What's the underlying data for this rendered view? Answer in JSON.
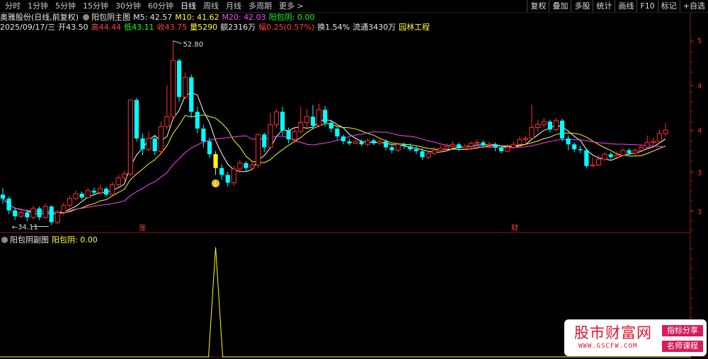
{
  "toolbar": {
    "tabs": [
      "分时",
      "1分钟",
      "5分钟",
      "15分钟",
      "30分钟",
      "60分钟",
      "日线",
      "周线",
      "月线",
      "多周期",
      "更多 >"
    ],
    "active_tab": "日线",
    "right_buttons": [
      "复权",
      "叠加",
      "多股",
      "统计",
      "画线",
      "F10",
      "标记",
      "+自选"
    ]
  },
  "info": {
    "stock_name": "奥雅股份(日线,前复权)",
    "indicator": "阳包阴主图",
    "ma5": "M5: 42.57",
    "ma10": "M10: 41.62",
    "ma20": "M20: 42.03",
    "ybyin": "阳包阴: 0.00",
    "date": "2025/09/17/三",
    "open": "开43.50",
    "high": "高44.44",
    "low": "低43.11",
    "close": "收43.75",
    "volume": "量5290",
    "amount": "额2316万",
    "change": "幅0.25(0.57%)",
    "turnover": "换1.54%",
    "float": "流通3430万",
    "sector": "园林工程"
  },
  "main_chart": {
    "max_label": "52.80",
    "min_label": "34.11",
    "marker_zhang": "涨",
    "marker_cai": "财",
    "right_ticks": [
      "5",
      "4",
      "4",
      "3",
      "3"
    ]
  },
  "sub_chart": {
    "title": "阳包阴副图",
    "value": "阳包阴: 0.00"
  },
  "watermark": {
    "main": "股市财富网",
    "url": "WWW.GSCFW.COM",
    "badge1": "指标分享",
    "badge2": "名师课程"
  },
  "colors": {
    "up": "#ff3030",
    "down": "#00ffff",
    "ma5": "#ffffff",
    "ma10": "#ffff00",
    "ma20": "#ff40ff",
    "signal": "#ffff00"
  },
  "chart_data": {
    "type": "candlestick",
    "candles": [
      [
        37.2,
        36.8,
        37.9,
        36.3
      ],
      [
        36.8,
        35.6,
        37.0,
        35.2
      ],
      [
        35.6,
        35.0,
        35.9,
        34.6
      ],
      [
        35.0,
        35.4,
        35.8,
        34.8
      ],
      [
        35.4,
        34.9,
        35.7,
        34.5
      ],
      [
        34.9,
        35.8,
        36.1,
        34.7
      ],
      [
        35.8,
        34.9,
        36.0,
        34.6
      ],
      [
        34.9,
        36.0,
        36.3,
        34.7
      ],
      [
        36.0,
        34.4,
        36.1,
        34.11
      ],
      [
        34.4,
        35.4,
        35.6,
        34.2
      ],
      [
        35.4,
        36.1,
        36.4,
        35.1
      ],
      [
        36.1,
        36.8,
        37.1,
        35.9
      ],
      [
        36.8,
        37.3,
        37.6,
        36.6
      ],
      [
        37.3,
        36.9,
        37.5,
        36.7
      ],
      [
        36.9,
        37.6,
        37.9,
        36.8
      ],
      [
        37.6,
        37.4,
        37.9,
        37.1
      ],
      [
        37.4,
        37.8,
        38.2,
        37.2
      ],
      [
        37.8,
        37.2,
        38.0,
        37.0
      ],
      [
        37.2,
        38.2,
        38.5,
        37.0
      ],
      [
        38.2,
        38.9,
        39.2,
        38.0
      ],
      [
        38.9,
        39.3,
        39.6,
        38.6
      ],
      [
        39.3,
        46.8,
        46.8,
        39.1
      ],
      [
        46.8,
        42.9,
        47.0,
        42.6
      ],
      [
        42.9,
        41.8,
        43.4,
        41.2
      ],
      [
        41.8,
        42.9,
        43.6,
        41.6
      ],
      [
        42.9,
        41.6,
        43.2,
        41.2
      ],
      [
        41.6,
        44.1,
        44.6,
        41.4
      ],
      [
        44.1,
        45.1,
        48.3,
        43.8
      ],
      [
        45.1,
        50.8,
        52.8,
        44.9
      ],
      [
        50.8,
        47.1,
        51.0,
        46.6
      ],
      [
        47.1,
        49.1,
        49.6,
        46.9
      ],
      [
        49.1,
        45.6,
        49.4,
        45.0
      ],
      [
        45.6,
        43.9,
        46.1,
        43.4
      ],
      [
        43.9,
        42.6,
        44.3,
        42.0
      ],
      [
        42.6,
        41.3,
        43.0,
        40.9
      ],
      [
        41.3,
        39.9,
        41.6,
        39.2
      ],
      [
        39.9,
        39.2,
        40.3,
        38.7
      ],
      [
        39.2,
        38.4,
        39.5,
        38.0
      ],
      [
        38.4,
        39.8,
        40.1,
        38.1
      ],
      [
        39.8,
        40.4,
        40.7,
        39.5
      ],
      [
        40.4,
        39.9,
        40.6,
        39.6
      ],
      [
        39.9,
        40.2,
        40.5,
        39.7
      ],
      [
        40.2,
        43.3,
        43.4,
        39.9
      ],
      [
        43.3,
        42.0,
        43.5,
        41.5
      ],
      [
        42.0,
        44.3,
        45.5,
        41.8
      ],
      [
        44.3,
        45.6,
        45.9,
        44.0
      ],
      [
        45.6,
        43.7,
        46.1,
        43.2
      ],
      [
        43.7,
        42.8,
        44.0,
        42.4
      ],
      [
        42.8,
        43.6,
        44.0,
        42.5
      ],
      [
        43.6,
        44.5,
        46.1,
        43.4
      ],
      [
        44.5,
        45.1,
        45.9,
        44.0
      ],
      [
        45.1,
        44.2,
        46.3,
        43.8
      ],
      [
        44.2,
        45.8,
        46.4,
        44.0
      ],
      [
        45.8,
        44.5,
        46.2,
        44.1
      ],
      [
        44.5,
        43.9,
        44.8,
        43.5
      ],
      [
        43.9,
        43.1,
        44.1,
        42.8
      ],
      [
        43.1,
        42.6,
        43.3,
        42.3
      ],
      [
        42.6,
        42.4,
        42.9,
        42.2
      ],
      [
        42.4,
        42.6,
        42.8,
        42.3
      ],
      [
        42.6,
        42.3,
        42.8,
        42.1
      ],
      [
        42.3,
        42.7,
        42.9,
        42.1
      ],
      [
        42.7,
        42.4,
        42.9,
        42.2
      ],
      [
        42.4,
        42.6,
        42.8,
        42.2
      ],
      [
        42.6,
        42.0,
        42.8,
        41.7
      ],
      [
        42.0,
        41.7,
        42.3,
        41.4
      ],
      [
        41.7,
        42.3,
        42.5,
        41.5
      ],
      [
        42.3,
        42.1,
        42.5,
        41.8
      ],
      [
        42.1,
        41.8,
        42.4,
        41.6
      ],
      [
        41.8,
        41.6,
        42.2,
        41.3
      ],
      [
        41.6,
        41.0,
        41.9,
        40.7
      ],
      [
        41.0,
        41.4,
        41.7,
        40.8
      ],
      [
        41.4,
        41.7,
        42.0,
        41.2
      ],
      [
        41.7,
        41.9,
        42.2,
        41.5
      ],
      [
        41.9,
        42.1,
        42.4,
        41.7
      ],
      [
        42.1,
        42.3,
        42.6,
        41.9
      ],
      [
        42.3,
        41.9,
        42.5,
        41.6
      ],
      [
        41.9,
        42.1,
        42.3,
        41.7
      ],
      [
        42.1,
        42.4,
        42.6,
        41.9
      ],
      [
        42.4,
        42.5,
        42.8,
        42.2
      ],
      [
        42.5,
        42.2,
        42.7,
        41.9
      ],
      [
        42.2,
        42.3,
        42.6,
        42.0
      ],
      [
        42.3,
        42.0,
        42.5,
        41.6
      ],
      [
        42.0,
        41.6,
        42.2,
        41.4
      ],
      [
        41.6,
        42.0,
        42.3,
        41.5
      ],
      [
        42.0,
        42.3,
        42.6,
        41.8
      ],
      [
        42.3,
        42.8,
        43.1,
        42.1
      ],
      [
        42.8,
        42.9,
        43.2,
        42.5
      ],
      [
        42.9,
        44.0,
        46.3,
        42.8
      ],
      [
        44.0,
        44.3,
        44.8,
        43.6
      ],
      [
        44.3,
        44.6,
        45.0,
        44.0
      ],
      [
        44.6,
        43.8,
        44.8,
        43.5
      ],
      [
        43.8,
        44.7,
        45.0,
        43.6
      ],
      [
        44.7,
        42.9,
        44.9,
        42.6
      ],
      [
        42.9,
        42.3,
        43.2,
        41.7
      ],
      [
        42.3,
        41.8,
        42.5,
        41.5
      ],
      [
        41.8,
        41.7,
        42.1,
        41.4
      ],
      [
        41.7,
        40.1,
        41.9,
        39.9
      ],
      [
        40.1,
        40.2,
        41.0,
        40.0
      ],
      [
        40.2,
        40.8,
        41.2,
        40.1
      ],
      [
        40.8,
        41.3,
        41.5,
        40.6
      ],
      [
        41.3,
        41.0,
        41.5,
        40.8
      ],
      [
        41.0,
        41.2,
        41.6,
        40.8
      ],
      [
        41.2,
        41.7,
        41.9,
        41.0
      ],
      [
        41.7,
        41.4,
        41.9,
        41.2
      ],
      [
        41.4,
        41.7,
        41.9,
        41.2
      ],
      [
        41.7,
        42.0,
        42.3,
        41.5
      ],
      [
        42.0,
        42.5,
        43.2,
        41.9
      ],
      [
        42.5,
        42.6,
        43.0,
        42.2
      ],
      [
        42.6,
        43.4,
        43.8,
        42.4
      ],
      [
        43.4,
        43.75,
        44.44,
        43.11
      ]
    ],
    "signal_index": 35,
    "max_value": 52.8,
    "min_value": 34.11
  }
}
